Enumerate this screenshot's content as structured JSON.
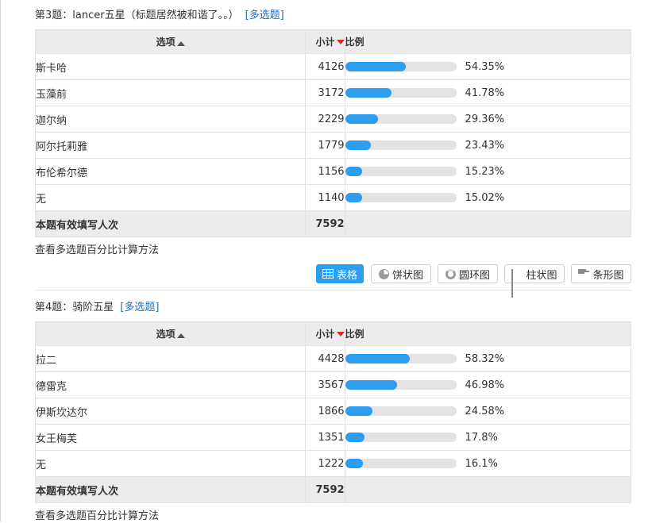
{
  "questions": [
    {
      "title": "第3题：lancer五星（标题居然被和谐了。。）",
      "multi_label": "[多选题]",
      "header": {
        "option": "选项",
        "count": "小计",
        "ratio": "比例"
      },
      "rows": [
        {
          "option": "斯卡哈",
          "count": "4126",
          "percent": "54.35%",
          "fraction": 0.5435
        },
        {
          "option": "玉藻前",
          "count": "3172",
          "percent": "41.78%",
          "fraction": 0.4178
        },
        {
          "option": "迦尔纳",
          "count": "2229",
          "percent": "29.36%",
          "fraction": 0.2936
        },
        {
          "option": "阿尔托莉雅",
          "count": "1779",
          "percent": "23.43%",
          "fraction": 0.2343
        },
        {
          "option": "布伦希尔德",
          "count": "1156",
          "percent": "15.23%",
          "fraction": 0.1523
        },
        {
          "option": "无",
          "count": "1140",
          "percent": "15.02%",
          "fraction": 0.1502
        }
      ],
      "total": {
        "label": "本题有效填写人次",
        "value": "7592"
      },
      "howto": "查看多选题百分比计算方法"
    },
    {
      "title": "第4题：骑阶五星",
      "multi_label": "[多选题]",
      "header": {
        "option": "选项",
        "count": "小计",
        "ratio": "比例"
      },
      "rows": [
        {
          "option": "拉二",
          "count": "4428",
          "percent": "58.32%",
          "fraction": 0.5832
        },
        {
          "option": "德雷克",
          "count": "3567",
          "percent": "46.98%",
          "fraction": 0.4698
        },
        {
          "option": "伊斯坎达尔",
          "count": "1866",
          "percent": "24.58%",
          "fraction": 0.2458
        },
        {
          "option": "女王梅芙",
          "count": "1351",
          "percent": "17.8%",
          "fraction": 0.178
        },
        {
          "option": "无",
          "count": "1222",
          "percent": "16.1%",
          "fraction": 0.161
        }
      ],
      "total": {
        "label": "本题有效填写人次",
        "value": "7592"
      },
      "howto": "查看多选题百分比计算方法"
    }
  ],
  "view_buttons": [
    {
      "label": "表格",
      "icon": "table-icon",
      "active": true
    },
    {
      "label": "饼状图",
      "icon": "pie-chart-icon",
      "active": false
    },
    {
      "label": "圆环图",
      "icon": "ring-chart-icon",
      "active": false
    },
    {
      "label": "柱状图",
      "icon": "column-chart-icon",
      "active": false
    },
    {
      "label": "条形图",
      "icon": "bar-chart-icon",
      "active": false
    }
  ],
  "colors": {
    "accent": "#2d9df0",
    "link": "#1a6fc4",
    "sort_active": "#d9261c"
  }
}
